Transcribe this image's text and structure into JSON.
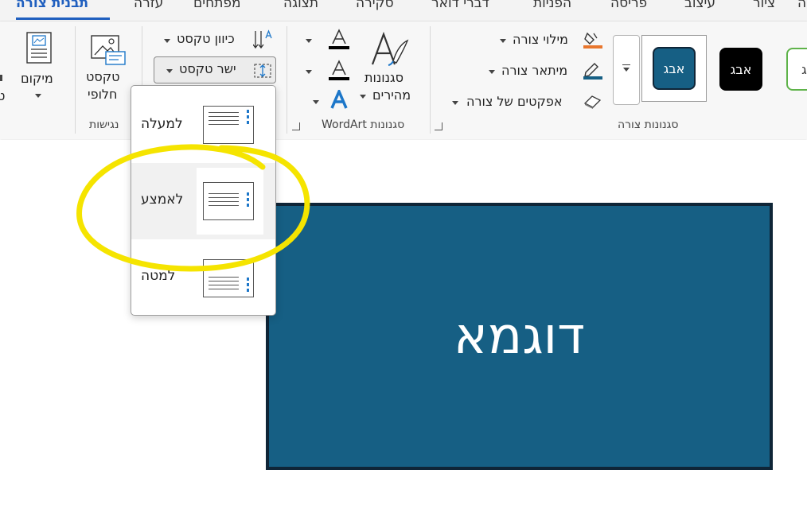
{
  "tabs": [
    {
      "label": "תבנית צורה",
      "active": true
    },
    {
      "label": "עזרה"
    },
    {
      "label": "מפתחים"
    },
    {
      "label": "תצוגה"
    },
    {
      "label": "סקירה"
    },
    {
      "label": "דברי דואר"
    },
    {
      "label": "הפניות"
    },
    {
      "label": "פריסה"
    },
    {
      "label": "עיצוב"
    },
    {
      "label": "ציור"
    },
    {
      "label": "ה"
    }
  ],
  "ribbon": {
    "shape_styles": {
      "group_label": "סגנונות צורה",
      "swatches": [
        {
          "label": "אבג",
          "style": "blue-rounded"
        },
        {
          "label": "אבג",
          "style": "black"
        },
        {
          "label": "בג",
          "style": "green-outline"
        }
      ],
      "fill_label": "מילוי צורה",
      "outline_label": "מיתאר צורה",
      "effects_label": "אפקטים של צורה"
    },
    "wordart_styles": {
      "group_label": "סגנונות WordArt",
      "quick_styles_label_1": "סגנונות",
      "quick_styles_label_2": "מהירים"
    },
    "text": {
      "direction_label": "כיוון טקסט",
      "align_label": "ישר טקסט"
    },
    "accessibility": {
      "group_label": "נגישות",
      "alt_text_label_1": "טקסט",
      "alt_text_label_2": "חלופי"
    },
    "arrange": {
      "position_label": "מיקום",
      "cut_label": "ט"
    }
  },
  "align_menu": {
    "options": [
      {
        "label": "למעלה",
        "mnemonic": "ע",
        "position": "top"
      },
      {
        "label": "לאמצע",
        "mnemonic": "א",
        "position": "middle",
        "hovered": true
      },
      {
        "label": "למטה",
        "mnemonic": "ט",
        "position": "bottom"
      }
    ]
  },
  "document": {
    "shape_text": "דוגמא"
  },
  "colors": {
    "accent": "#1f5fbf",
    "shape_fill": "#165f84",
    "highlight": "#f5e400"
  }
}
